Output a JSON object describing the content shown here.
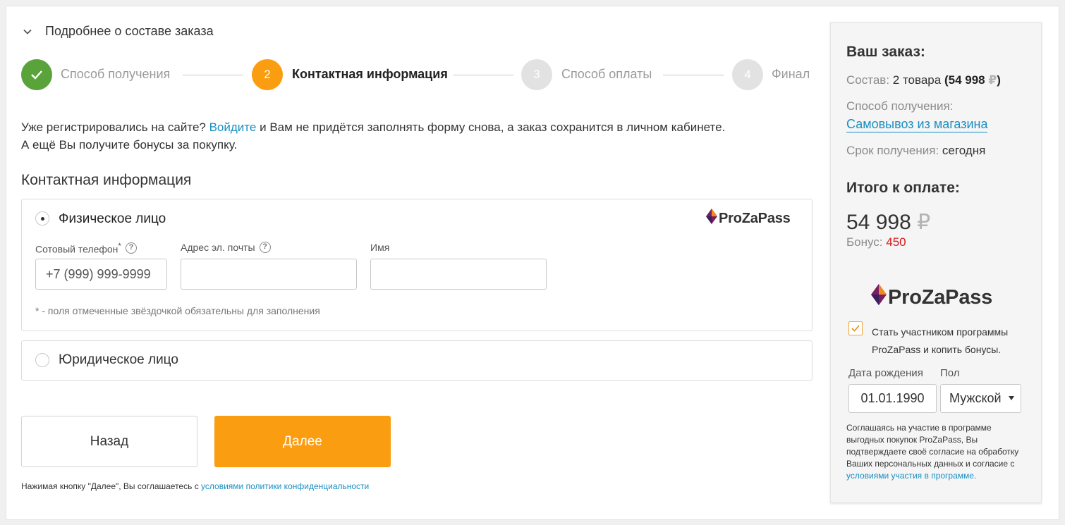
{
  "header": {
    "details_toggle": "Подробнее о составе заказа"
  },
  "stepper": {
    "steps": [
      {
        "number": "",
        "label": "Способ получения",
        "state": "done"
      },
      {
        "number": "2",
        "label": "Контактная информация",
        "state": "active"
      },
      {
        "number": "3",
        "label": "Способ оплаты",
        "state": "pending"
      },
      {
        "number": "4",
        "label": "Финал",
        "state": "pending"
      }
    ]
  },
  "intro": {
    "text_before": "Уже регистрировались на сайте?",
    "login_link": "Войдите",
    "text_after": "и Вам не придётся заполнять форму снова, а заказ сохранится в личном кабинете.",
    "line2": "А ещё Вы получите бонусы за покупку."
  },
  "contact": {
    "title": "Контактная информация",
    "individual": {
      "label": "Физическое лицо",
      "selected": true,
      "logo_text": "ProZaPass",
      "fields": {
        "phone_label": "Сотовый телефон",
        "phone_required_mark": "*",
        "phone_placeholder": "+7 (999) 999-9999",
        "email_label": "Адрес эл. почты",
        "email_value": "",
        "name_label": "Имя",
        "name_value": ""
      },
      "required_note": "* - поля отмеченные звёздочкой обязательны для заполнения"
    },
    "legal": {
      "label": "Юридическое лицо",
      "selected": false
    }
  },
  "buttons": {
    "back": "Назад",
    "next": "Далее"
  },
  "policy": {
    "text": "Нажимая кнопку \"Далее\", Вы соглашаетесь с",
    "link": "условиями политики конфиденциальности"
  },
  "sidebar": {
    "title": "Ваш заказ:",
    "composition_label": "Состав:",
    "composition_value": "2 товара",
    "composition_sum": "54 998",
    "currency": "₽",
    "pickup_label": "Способ получения:",
    "pickup_value": "Самовывоз из магазина",
    "term_label": "Срок получения:",
    "term_value": "сегодня",
    "total_title": "Итого к оплате:",
    "total_amount": "54 998",
    "bonus_label": "Бонус:",
    "bonus_value": "450",
    "logo_text": "ProZaPass",
    "program_checkbox_label": "Стать участником программы ProZaPass и копить бонусы.",
    "program_checked": true,
    "dob_label": "Дата рождения",
    "dob_value": "01.01.1990",
    "gender_label": "Пол",
    "gender_value": "Мужской",
    "consent_text": "Соглашаясь на участие в программе выгодных покупок ProZaPass, Вы подтверждаете своё согласие на обработку Ваших персональных данных и согласие с",
    "consent_link": "условиями участия в программе."
  },
  "colors": {
    "step_done": "#5aa33a",
    "step_active": "#fb9d10",
    "step_pending": "#e2e2e2",
    "accent_orange": "#fb9d10",
    "link_blue": "#1a8fc2",
    "bonus_red": "#d9181b"
  },
  "icons": {
    "details_toggle": "chevron-down-icon",
    "step_done": "check-icon",
    "help": "question-circle-icon",
    "gender_select": "caret-down-icon",
    "checkbox": "checkmark-icon"
  }
}
